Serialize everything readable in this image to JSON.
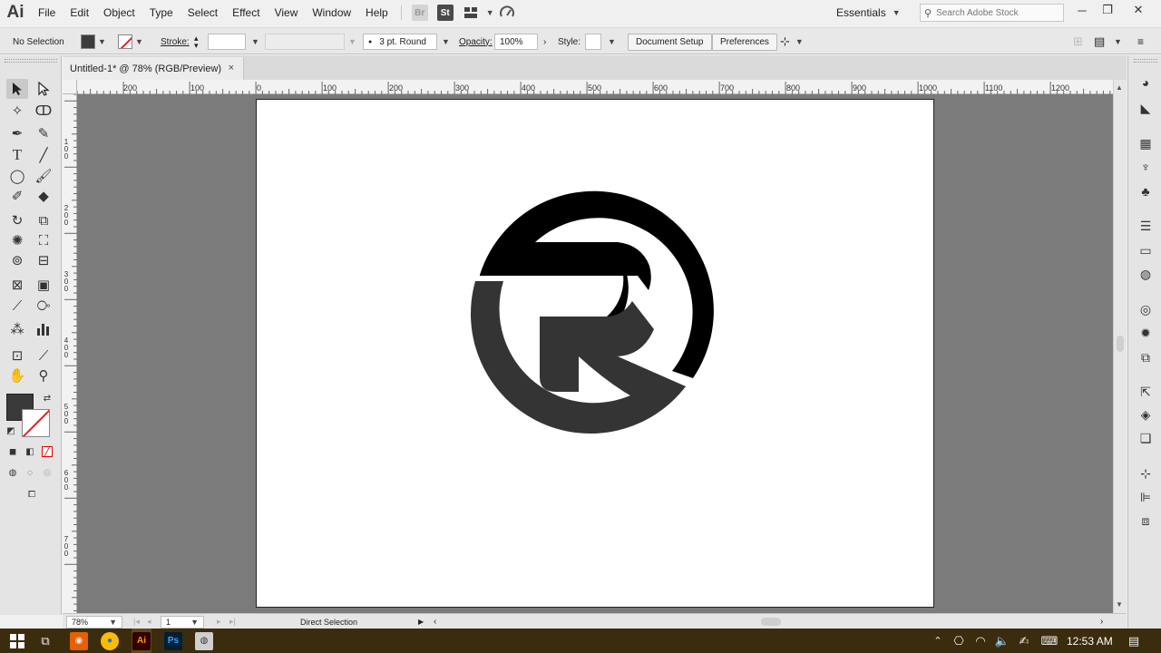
{
  "app": {
    "logo": "Ai"
  },
  "menu": [
    "File",
    "Edit",
    "Object",
    "Type",
    "Select",
    "Effect",
    "View",
    "Window",
    "Help"
  ],
  "toolbar_icons": {
    "bridge": "Br",
    "stock": "St"
  },
  "workspace": {
    "label": "Essentials"
  },
  "search": {
    "placeholder": "Search Adobe Stock"
  },
  "control": {
    "selection": "No Selection",
    "stroke_label": "Stroke:",
    "brush": "3 pt. Round",
    "opacity_label": "Opacity:",
    "opacity_value": "100%",
    "style_label": "Style:",
    "document_setup": "Document Setup",
    "preferences": "Preferences"
  },
  "document": {
    "tab_title": "Untitled-1* @ 78% (RGB/Preview)",
    "close": "×"
  },
  "ruler_h": [
    "200",
    "100",
    "0",
    "100",
    "200",
    "300",
    "400",
    "500",
    "600",
    "700",
    "800",
    "900",
    "1000",
    "1100",
    "1200"
  ],
  "ruler_v": [
    "1\n0\n0",
    "2\n0\n0",
    "3\n0\n0",
    "4\n0\n0",
    "5\n0\n0",
    "6\n0\n0",
    "7\n0\n0"
  ],
  "status": {
    "zoom": "78%",
    "page": "1",
    "tool": "Direct Selection"
  },
  "taskbar": {
    "time": "12:53 AM",
    "ai": "Ai",
    "ps": "Ps"
  },
  "colors": {
    "logo_black": "#000000",
    "logo_dark": "#353435",
    "canvas_bg": "#7b7b7b",
    "taskbar": "#3a2c0c"
  }
}
